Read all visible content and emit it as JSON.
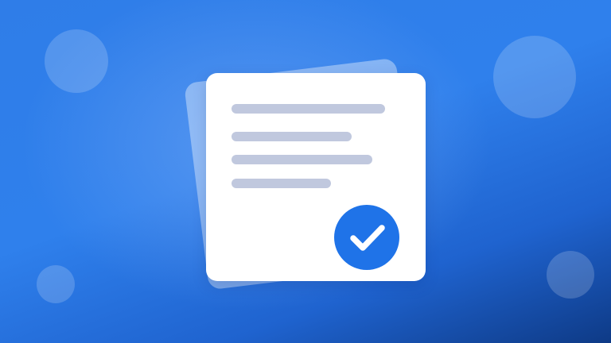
{
  "illustration": {
    "subject": "document-with-checkmark",
    "icons": [
      "document-icon",
      "checkmark-icon"
    ],
    "colors": {
      "background_top": "#2f7de8",
      "background_bottom": "#0e3a86",
      "card": "#ffffff",
      "text_lines": "#c0c8de",
      "badge": "#1f73e8",
      "check": "#ffffff"
    }
  }
}
